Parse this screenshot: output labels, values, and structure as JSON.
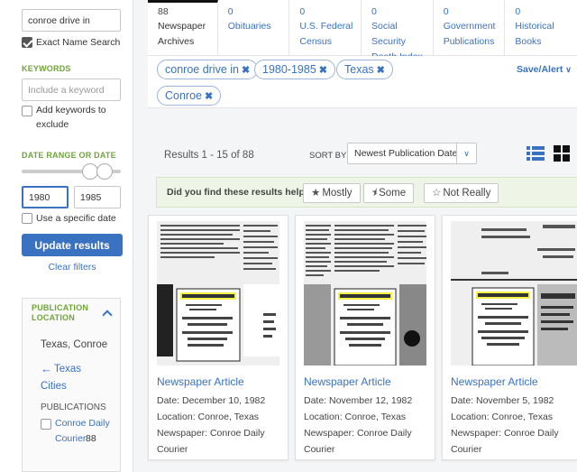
{
  "sidebar": {
    "name_value": "conroe drive in",
    "exact_name_label": "Exact Name Search",
    "keywords_heading": "KEYWORDS",
    "keyword_placeholder": "Include a keyword",
    "add_keywords_label": "Add keywords to",
    "add_keywords_label2": "exclude",
    "date_range_heading": "DATE RANGE OR DATE",
    "date_from": "1980",
    "date_to": "1985",
    "specific_date_label": "Use a specific date",
    "update_button": "Update results",
    "clear_filters": "Clear filters",
    "pub_location_heading1": "PUBLICATION",
    "pub_location_heading2": "LOCATION",
    "location_value": "Texas, Conroe",
    "back_link1": "Texas",
    "back_link2": "Cities",
    "publications_heading": "PUBLICATIONS",
    "pub_name1": "Conroe Daily",
    "pub_name2": "Courier",
    "pub_count": "88"
  },
  "tabs": [
    {
      "count": "88",
      "label1": "Newspaper",
      "label2": "Archives",
      "active": true
    },
    {
      "count": "0",
      "label1": "Obituaries",
      "label2": ""
    },
    {
      "count": "0",
      "label1": "U.S. Federal",
      "label2": "Census"
    },
    {
      "count": "0",
      "label1": "Social Security",
      "label2": "Death Index"
    },
    {
      "count": "0",
      "label1": "Government",
      "label2": "Publications"
    },
    {
      "count": "0",
      "label1": "Historical",
      "label2": "Books"
    }
  ],
  "filters": {
    "chips": [
      "conroe drive in",
      "1980-1985",
      "Texas",
      "Conroe"
    ],
    "save_alert": "Save/Alert"
  },
  "results": {
    "count_text": "Results 1 - 15 of 88",
    "sort_label": "SORT BY",
    "sort_value": "Newest Publication Date"
  },
  "helpful": {
    "question": "Did you find these results helpful?",
    "mostly": "Mostly",
    "some": "Some",
    "not_really": "Not Really"
  },
  "cards": [
    {
      "title": "Newspaper Article",
      "date": "Date: December 10, 1982",
      "location": "Location: Conroe, Texas",
      "newspaper1": "Newspaper: Conroe Daily",
      "newspaper2": "Courier"
    },
    {
      "title": "Newspaper Article",
      "date": "Date: November 12, 1982",
      "location": "Location: Conroe, Texas",
      "newspaper1": "Newspaper: Conroe Daily",
      "newspaper2": "Courier"
    },
    {
      "title": "Newspaper Article",
      "date": "Date: November 5, 1982",
      "location": "Location: Conroe, Texas",
      "newspaper1": "Newspaper: Conroe Daily",
      "newspaper2": "Courier"
    }
  ],
  "colors": {
    "accent": "#3a72c2",
    "green": "#6fa43a",
    "highlight": "#f4f04a"
  }
}
